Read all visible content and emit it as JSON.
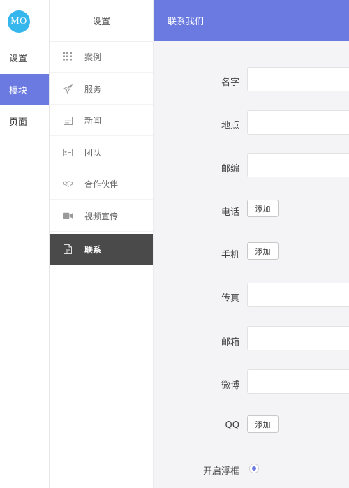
{
  "logo": {
    "text": "MO"
  },
  "nav1": [
    {
      "label": "设置"
    },
    {
      "label": "模块"
    },
    {
      "label": "页面"
    }
  ],
  "nav2": {
    "title": "设置",
    "items": [
      {
        "label": "案例",
        "icon": "grid-icon"
      },
      {
        "label": "服务",
        "icon": "paper-plane-icon"
      },
      {
        "label": "新闻",
        "icon": "calendar-icon"
      },
      {
        "label": "团队",
        "icon": "id-card-icon"
      },
      {
        "label": "合作伙伴",
        "icon": "handshake-icon"
      },
      {
        "label": "视频宣传",
        "icon": "video-camera-icon"
      },
      {
        "label": "联系",
        "icon": "document-icon"
      }
    ]
  },
  "header": {
    "title": "联系我们"
  },
  "form": {
    "name_label": "名字",
    "location_label": "地点",
    "postcode_label": "邮编",
    "phone_label": "电话",
    "phone_add": "添加",
    "mobile_label": "手机",
    "mobile_add": "添加",
    "fax_label": "传真",
    "email_label": "邮箱",
    "weibo_label": "微博",
    "qq_label": "QQ",
    "qq_add": "添加",
    "float_label": "开启浮框"
  },
  "colors": {
    "accent": "#6a7ae0",
    "logo": "#35b7ee",
    "active_dark": "#4a4a4a"
  }
}
